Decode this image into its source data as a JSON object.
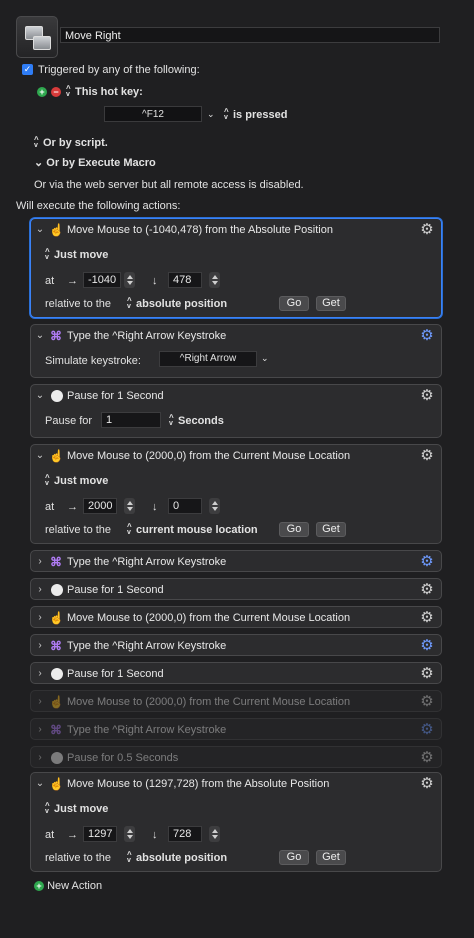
{
  "macro": {
    "name": "Move Right",
    "trigger_label": "Triggered by any of the following:",
    "hotkey_label": "This hot key:",
    "hotkey_value": "^F12",
    "hotkey_state": "is pressed",
    "or_script": "Or by script.",
    "or_execute": "Or by Execute Macro",
    "web_note": "Or via the web server but all remote access is disabled.",
    "actions_label": "Will execute the following actions:",
    "new_action": "New Action"
  },
  "labels": {
    "just_move": "Just move",
    "at": "at",
    "relative_to": "relative to the",
    "go": "Go",
    "get": "Get",
    "simulate": "Simulate keystroke:",
    "pause_for": "Pause for",
    "seconds": "Seconds",
    "right_arrow": "→",
    "down_arrow": "↓"
  },
  "actions": [
    {
      "title": "Move Mouse to (-1040,478) from the Absolute Position",
      "x": "-1040",
      "y": "478",
      "relative": "absolute position"
    },
    {
      "title": "Type the ^Right Arrow Keystroke",
      "keystroke": "^Right Arrow"
    },
    {
      "title": "Pause for 1 Second",
      "pause": "1"
    },
    {
      "title": "Move Mouse to (2000,0) from the Current Mouse Location",
      "x": "2000",
      "y": "0",
      "relative": "current mouse location"
    },
    {
      "title": "Type the ^Right Arrow Keystroke"
    },
    {
      "title": "Pause for 1 Second"
    },
    {
      "title": "Move Mouse to (2000,0) from the Current Mouse Location"
    },
    {
      "title": "Type the ^Right Arrow Keystroke"
    },
    {
      "title": "Pause for 1 Second"
    },
    {
      "title": "Move Mouse to (2000,0) from the Current Mouse Location"
    },
    {
      "title": "Type the ^Right Arrow Keystroke"
    },
    {
      "title": "Pause for 0.5 Seconds"
    },
    {
      "title": "Move Mouse to (1297,728) from the Absolute Position",
      "x": "1297",
      "y": "728",
      "relative": "absolute position"
    }
  ],
  "colors": {
    "accent": "#2f7df6",
    "selection": "#3b82f6",
    "keystroke_icon": "#b07bf5"
  }
}
